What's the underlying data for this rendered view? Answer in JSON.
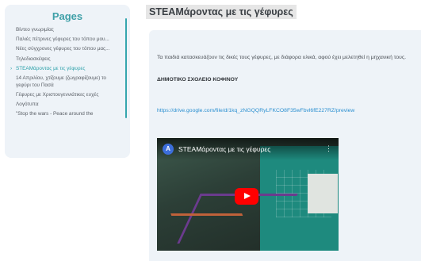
{
  "sidebar": {
    "title": "Pages",
    "items": [
      {
        "label": "Βίντεο γνωριμίας"
      },
      {
        "label": "Παλιές πέτρινες γέφυρες του τόπου μου..."
      },
      {
        "label": "Νέες σύγχρονες γέφυρες του τόπου μας..."
      },
      {
        "label": "Τηλεδιασκέψεις"
      },
      {
        "label": "STEAMάροντας με τις γέφυρες"
      },
      {
        "label": "14 Απριλίου, χτίζουμε (ζωγραφίζουμε) το γεφύρι του Πασά"
      },
      {
        "label": "Γέφυρες με Χριστουγεννιάτικες ευχές"
      },
      {
        "label": "Λογότυπα"
      },
      {
        "label": "\"Stop the wars - Peace around the"
      }
    ],
    "active_arrow": "›"
  },
  "main": {
    "title": "STEAMάροντας με τις γέφυρες",
    "description": "Τα παιδιά κατασκευάζουν τις δικές τους γέφυρες, με διάφορα υλικά, αφού έχει μελετηθεί η μηχανική τους.",
    "school": "ΔΗΜΟΤΙΚΟ ΣΧΟΛΕΙΟ ΚΟΦΙΝΟΥ",
    "link": "https://drive.google.com/file/d/1kq_zNGQQRyLFKCO8F35wFbvl6fE227RZ/preview"
  },
  "video": {
    "avatar_letter": "A",
    "title": "STEAMάροντας με τις γέφυρες",
    "menu_glyph": "⋮"
  }
}
